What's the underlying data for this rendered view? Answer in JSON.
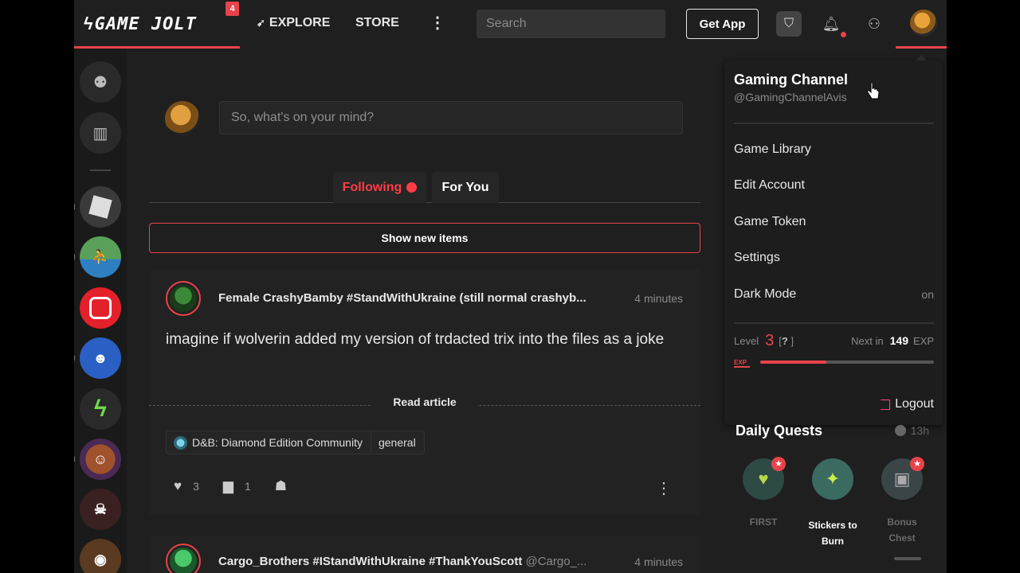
{
  "header": {
    "logo_text": "GAME JOLT",
    "logo_badge": "4",
    "nav": {
      "explore": "EXPLORE",
      "store": "STORE"
    },
    "search_placeholder": "Search",
    "get_app": "Get App"
  },
  "feed": {
    "composer_placeholder": "So, what's on your mind?",
    "tabs": [
      {
        "label": "Following"
      },
      {
        "label": "For You"
      }
    ],
    "show_new": "Show new items",
    "posts": [
      {
        "author": "Female CrashyBamby #StandWithUkraine (still normal crashyb...",
        "time": "4 minutes",
        "body": "imagine if wolverin added my version of trdacted trix into the files as a joke",
        "read_article": "Read article",
        "community": "D&B: Diamond Edition Community",
        "channel": "general",
        "likes": "3",
        "comments": "1"
      },
      {
        "author": "Cargo_Brothers #IStandWithUkraine #ThankYouScott",
        "handle": "@Cargo_...",
        "time": "4 minutes"
      }
    ]
  },
  "user_menu": {
    "name": "Gaming Channel",
    "handle": "@GamingChannelAvis",
    "items": [
      {
        "label": "Game Library"
      },
      {
        "label": "Edit Account"
      },
      {
        "label": "Game Token"
      },
      {
        "label": "Settings"
      },
      {
        "label": "Dark Mode",
        "value": "on"
      }
    ],
    "level_label": "Level",
    "level": "3",
    "level_help": "?",
    "next_label": "Next in",
    "next_exp": "149",
    "exp_label": "EXP",
    "exp_progress": 0.38,
    "logout": "Logout"
  },
  "quests": {
    "title": "Daily Quests",
    "timer": "13h",
    "items": [
      {
        "label": "FIRST",
        "active": false
      },
      {
        "label": "Stickers to Burn",
        "active": true
      },
      {
        "label": "Bonus Chest",
        "active": false
      }
    ]
  },
  "colors": {
    "accent": "#e8434a",
    "background": "#1f1f1f",
    "card": "#222222"
  }
}
